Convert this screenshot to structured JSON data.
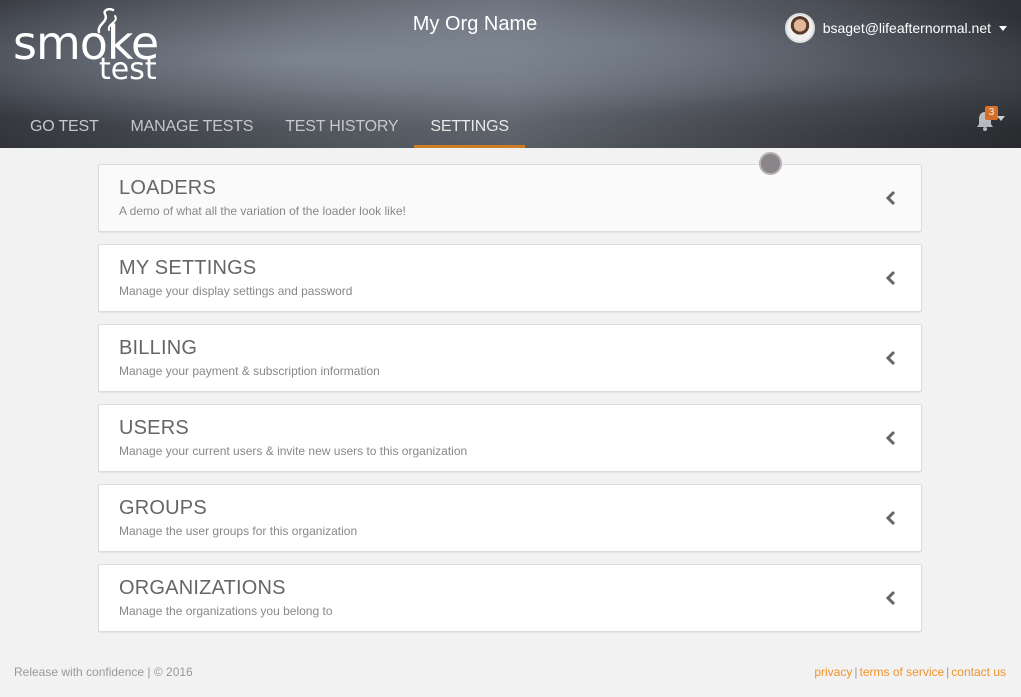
{
  "header": {
    "logo_main": "smoke",
    "logo_sub": "test",
    "org_name": "My Org Name",
    "user_email": "bsaget@lifeafternormal.net",
    "notification_count": "3"
  },
  "nav": {
    "tabs": [
      {
        "label": "GO TEST",
        "active": false
      },
      {
        "label": "MANAGE TESTS",
        "active": false
      },
      {
        "label": "TEST HISTORY",
        "active": false
      },
      {
        "label": "SETTINGS",
        "active": true
      }
    ]
  },
  "settings": {
    "items": [
      {
        "title": "LOADERS",
        "description": "A demo of what all the variation of the loader look like!"
      },
      {
        "title": "MY SETTINGS",
        "description": "Manage your display settings and password"
      },
      {
        "title": "BILLING",
        "description": "Manage your payment & subscription information"
      },
      {
        "title": "USERS",
        "description": "Manage your current users & invite new users to this organization"
      },
      {
        "title": "GROUPS",
        "description": "Manage the user groups for this organization"
      },
      {
        "title": "ORGANIZATIONS",
        "description": "Manage the organizations you belong to"
      }
    ]
  },
  "footer": {
    "tagline": "Release with confidence | © 2016",
    "links": [
      "privacy",
      "terms of service",
      "contact us"
    ],
    "separator": "|"
  },
  "colors": {
    "accent": "#f0922b",
    "badge": "#e2762b",
    "page_background": "#f2f2f2"
  },
  "icons": [
    "smoke-wisp-icon",
    "chevron-down-icon",
    "bell-icon",
    "chevron-left-icon"
  ]
}
